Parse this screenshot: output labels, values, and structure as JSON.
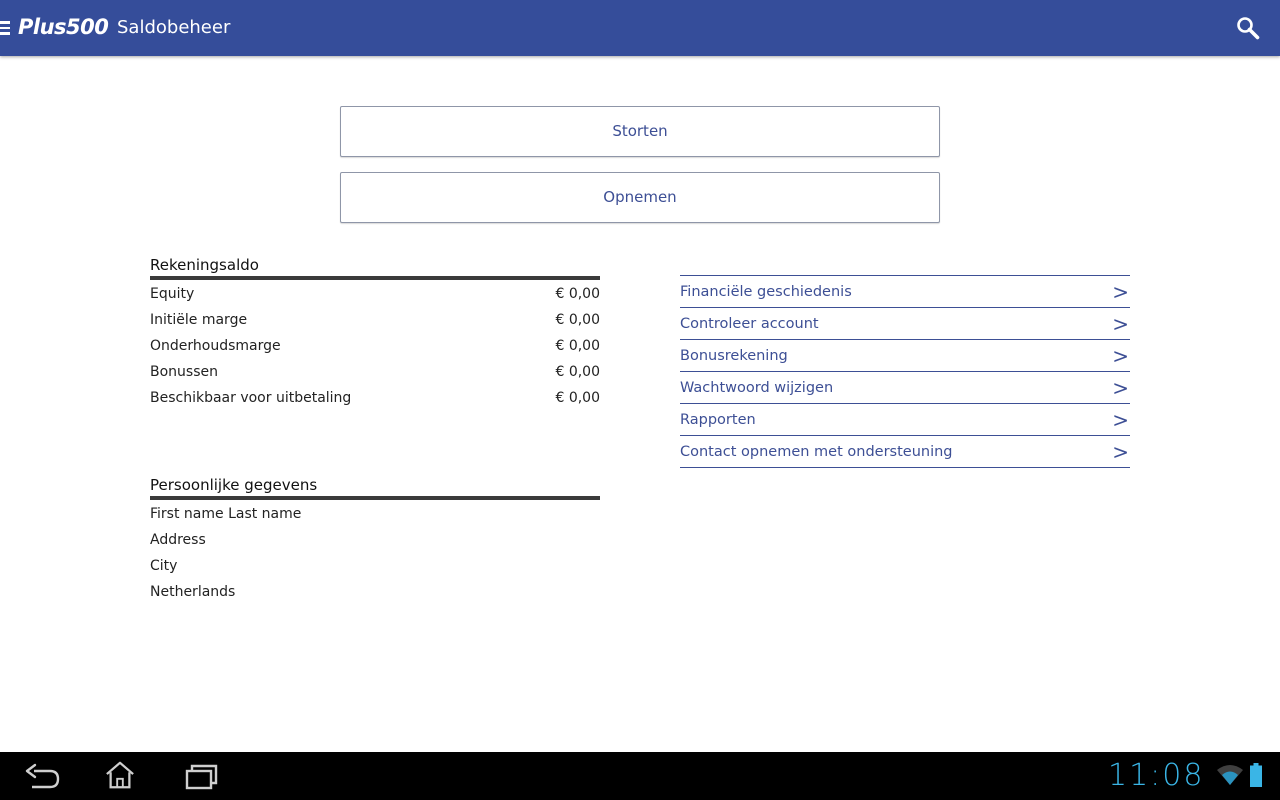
{
  "header": {
    "brand": "Plus500",
    "brand_text": "Plus500",
    "title": "Saldobeheer",
    "bg_color": "#354d9a"
  },
  "icons": {
    "menu": "menu-icon",
    "search": "search-icon",
    "back": "back-icon",
    "home": "home-icon",
    "recents": "recent-apps-icon",
    "wifi": "wifi-icon",
    "battery": "battery-icon"
  },
  "actions": {
    "deposit_label": "Storten",
    "withdraw_label": "Opnemen"
  },
  "balance": {
    "title": "Rekeningsaldo",
    "rows": [
      {
        "label": "Equity",
        "value": "€ 0,00"
      },
      {
        "label": "Initiële marge",
        "value": "€ 0,00"
      },
      {
        "label": "Onderhoudsmarge",
        "value": "€ 0,00"
      },
      {
        "label": "Bonussen",
        "value": "€ 0,00"
      },
      {
        "label": "Beschikbaar voor uitbetaling",
        "value": "€ 0,00"
      }
    ]
  },
  "personal": {
    "title": "Persoonlijke gegevens",
    "lines": [
      "First name Last name",
      "Address",
      "City",
      "Netherlands"
    ]
  },
  "nav": {
    "items": [
      {
        "label": "Financiële geschiedenis"
      },
      {
        "label": "Controleer account"
      },
      {
        "label": "Bonusrekening"
      },
      {
        "label": "Wachtwoord wijzigen"
      },
      {
        "label": "Rapporten"
      },
      {
        "label": "Contact opnemen met ondersteuning"
      }
    ],
    "chevron": ">",
    "accent_color": "#3d4f95"
  },
  "status_bar": {
    "time": "11:08",
    "accent_color": "#3ab5e6"
  }
}
